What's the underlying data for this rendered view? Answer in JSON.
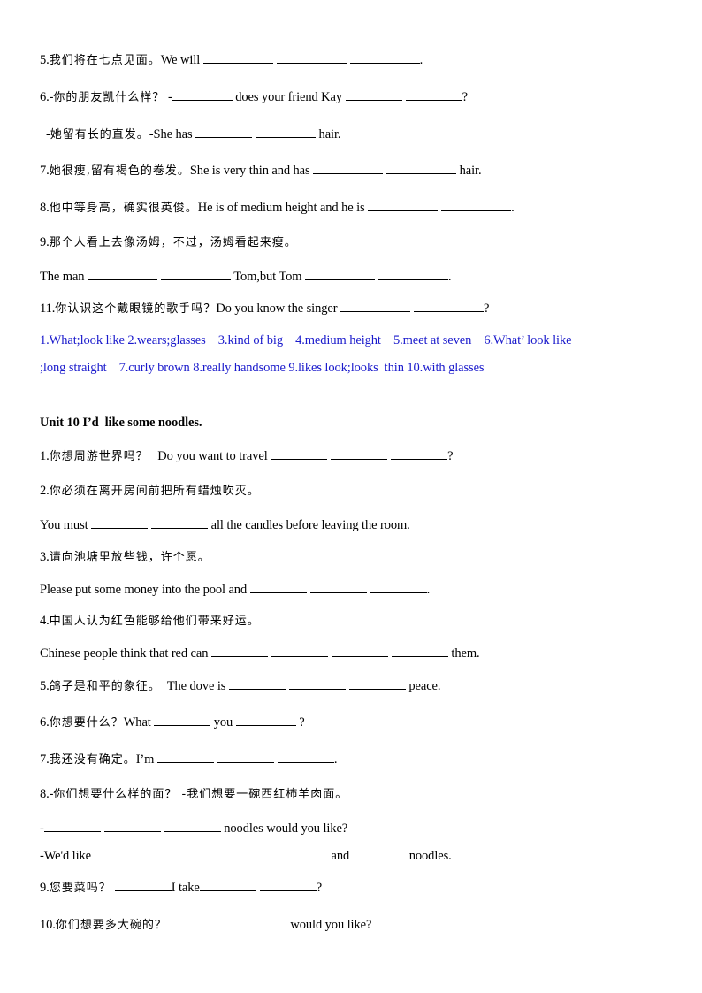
{
  "unit9_tail": {
    "q5": {
      "num": "5.",
      "zh": "我们将在七点见面。",
      "en_pre": "We will ",
      "end": "."
    },
    "q6a": {
      "num": "6.-",
      "zh": "你的朋友凯什么样？",
      "en_pre": " -",
      "mid": " does your friend Kay ",
      "end": "?"
    },
    "q6b": {
      "pre": "-",
      "zh": "她留有长的直发。",
      "en_pre": "-She has ",
      "end": " hair."
    },
    "q7": {
      "num": "7.",
      "zh": "她很瘦,留有褐色的卷发。",
      "en_pre": "She is very thin and has ",
      "end": " hair."
    },
    "q8": {
      "num": "8.",
      "zh": "他中等身高，确实很英俊。",
      "en_pre": "He is of medium height and he is ",
      "end": "."
    },
    "q9": {
      "num": "9.",
      "zh": "那个人看上去像汤姆，不过，汤姆看起来瘦。"
    },
    "q9en": {
      "pre": "The man ",
      "mid": " Tom,but  Tom ",
      "end": "."
    },
    "q11": {
      "num": "11.",
      "zh": "你认识这个戴眼镜的歌手吗？",
      "en_pre": "Do you know the singer ",
      "end": "?"
    },
    "answers_line1": "1.What;look like 2.wears;glasses    3.kind of big    4.medium height    5.meet at seven    6.What’ look like",
    "answers_line2": ";long straight    7.curly brown 8.really handsome 9.likes look;looks  thin 10.with glasses"
  },
  "unit10": {
    "heading": "Unit 10 I’d  like some noodles.",
    "q1": {
      "num": "1.",
      "zh": "你想周游世界吗？",
      "en_pre": "   Do you want to travel ",
      "end": "?"
    },
    "q2": {
      "num": "2.",
      "zh": "你必须在离开房间前把所有蜡烛吹灭。"
    },
    "q2en": {
      "pre": "You must ",
      "end": " all the candles before leaving the room."
    },
    "q3": {
      "num": "3.",
      "zh": "请向池塘里放些钱，许个愿。"
    },
    "q3en": {
      "pre": "Please put some money into the pool and ",
      "end": "."
    },
    "q4": {
      "num": "4.",
      "zh": "中国人认为红色能够给他们带来好运。"
    },
    "q4en": {
      "pre": "Chinese people think that red can ",
      "end": " them."
    },
    "q5": {
      "num": "5.",
      "zh": "鸽子是和平的象征。",
      "en_pre": "  The dove is ",
      "end": " peace."
    },
    "q6": {
      "num": "6.",
      "zh": "你想要什么？",
      "en_pre": "What ",
      "mid": " you ",
      "end": " ?"
    },
    "q7": {
      "num": "7.",
      "zh": "我还没有确定。",
      "en_pre": "I’m ",
      "end": "."
    },
    "q8": {
      "num": "8.-",
      "zh": "你们想要什么样的面？ -我们想要一碗西红柿羊肉面。"
    },
    "q8a": {
      "pre": "-",
      "end": " noodles would you like?"
    },
    "q8b": {
      "pre": "-We'd like ",
      "mid": "and ",
      "end": "noodles."
    },
    "q9": {
      "num": "9.",
      "zh": "您要菜吗？",
      "mid": "I take",
      "end": "?"
    },
    "q10": {
      "num": "10.",
      "zh": "你们想要多大碗的？",
      "end": " would you like?"
    }
  }
}
